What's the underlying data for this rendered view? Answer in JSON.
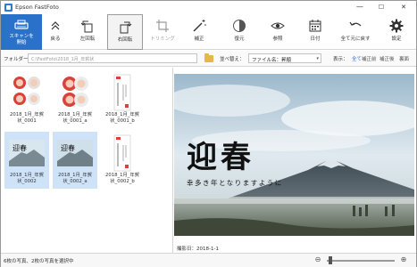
{
  "window": {
    "title": "Epson FastFoto",
    "minimize": "—",
    "maximize": "☐",
    "close": "✕"
  },
  "toolbar": {
    "scan_label_1": "スキャンを",
    "scan_label_2": "開始",
    "back": "戻る",
    "rotate_left": "左回転",
    "rotate_right": "右回転",
    "trim": "トリミング",
    "correct": "補正",
    "restore": "復元",
    "reference": "参照",
    "date": "日付",
    "restore_all": "全て元に戻す",
    "settings": "設定"
  },
  "filterbar": {
    "folder_label": "フォルダー：",
    "path": "C:\\FastFoto\\2018_1月_年賀状",
    "sort_label": "並べ替え：",
    "sort_value": "ファイル名：昇順",
    "display_label": "表示：",
    "display_all": "全て",
    "display_front": "補正前",
    "display_corrected": "補正後",
    "display_back": "裏面"
  },
  "thumbnails": [
    {
      "caption_1": "2018_1月_年賀",
      "caption_2": "状_0001",
      "selected": false
    },
    {
      "caption_1": "2018_1月_年賀",
      "caption_2": "状_0001_a",
      "selected": false
    },
    {
      "caption_1": "2018_1月_年賀",
      "caption_2": "状_0001_b",
      "selected": false
    },
    {
      "caption_1": "2018_1月_年賀",
      "caption_2": "状_0002",
      "selected": true
    },
    {
      "caption_1": "2018_1月_年賀",
      "caption_2": "状_0002_a",
      "selected": true
    },
    {
      "caption_1": "2018_1月_年賀",
      "caption_2": "状_0002_b",
      "selected": false
    }
  ],
  "preview": {
    "headline": "迎春",
    "subline": "幸多き年となりますように",
    "shot_date": "撮影日：2018-1-1"
  },
  "statusbar": {
    "text": "6枚の写真、2枚の写真を選択中",
    "zoom_minus": "⊖",
    "zoom_plus": "⊕",
    "zoom_level": 0.03
  },
  "colors": {
    "accent": "#2a72c9",
    "selection": "#cfe3f8"
  }
}
